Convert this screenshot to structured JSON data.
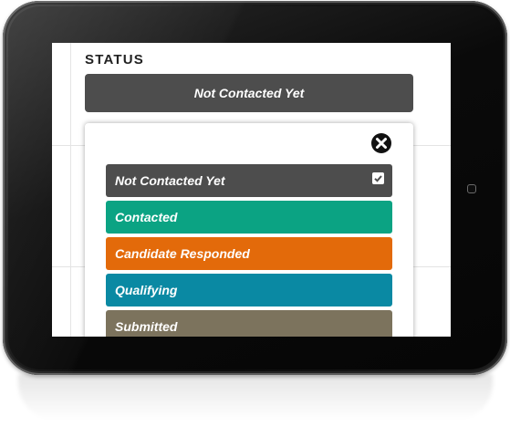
{
  "status": {
    "title": "STATUS",
    "current": "Not Contacted Yet"
  },
  "options": [
    {
      "label": "Not Contacted Yet",
      "color": "#4d4d4d",
      "selected": true
    },
    {
      "label": "Contacted",
      "color": "#0ba383",
      "selected": false
    },
    {
      "label": "Candidate Responded",
      "color": "#e36a0a",
      "selected": false
    },
    {
      "label": "Qualifying",
      "color": "#0a89a3",
      "selected": false
    },
    {
      "label": "Submitted",
      "color": "#7c735d",
      "selected": false
    }
  ],
  "icons": {
    "close": "close-circle-icon",
    "check": "checkbox-checked-icon",
    "home": "home-button-icon"
  }
}
